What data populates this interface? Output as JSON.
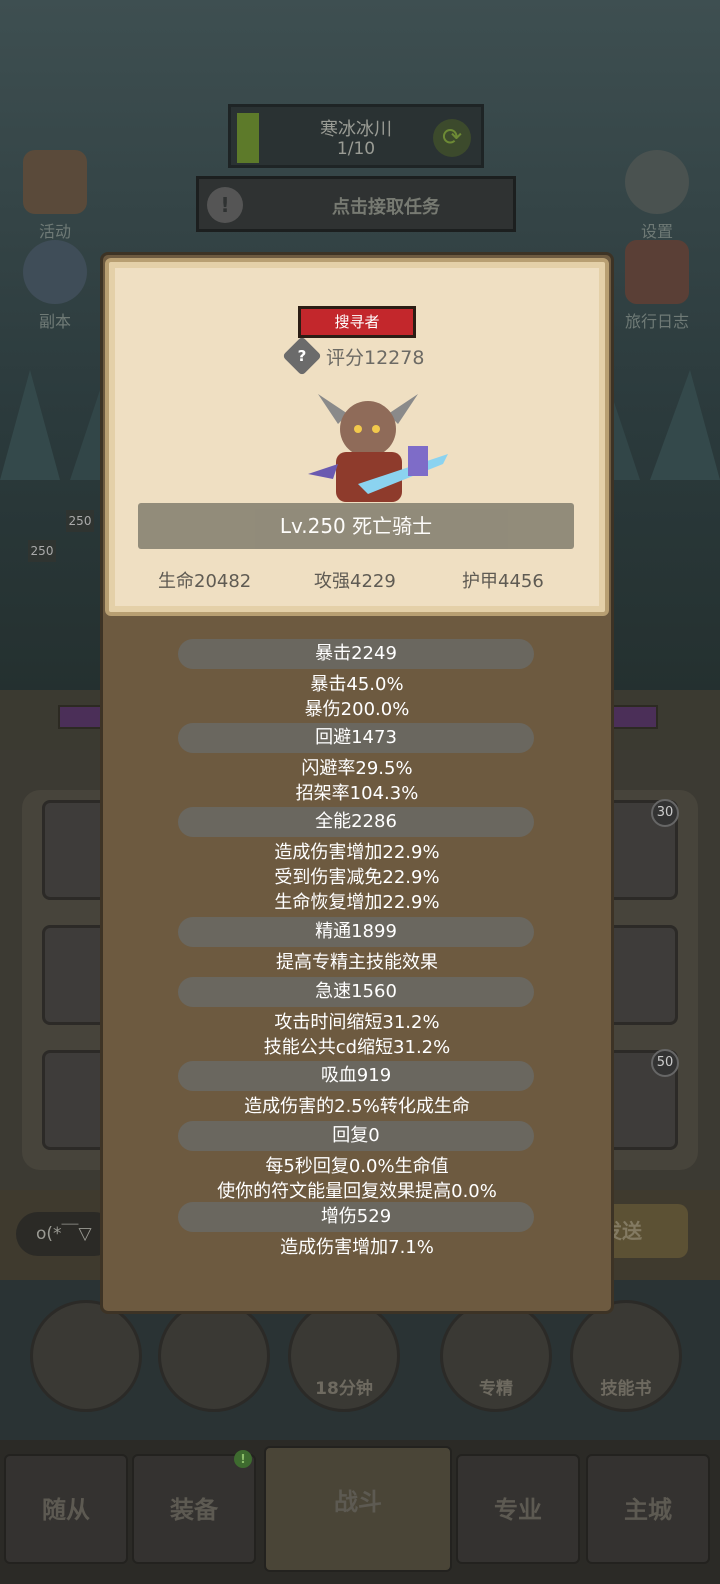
{
  "background": {
    "top_progress": {
      "title": "寒冰冰川",
      "progress": "1/10"
    },
    "task_text": "点击接取任务",
    "left_buttons": [
      {
        "label": "活动"
      },
      {
        "label": "副本"
      }
    ],
    "right_buttons": [
      {
        "label": "设置"
      },
      {
        "label": "旅行日志"
      }
    ],
    "level_badges": [
      "250",
      "250"
    ],
    "slot_badges": [
      "30",
      "50"
    ],
    "chat": {
      "input_text": "o(*￣▽",
      "send_label": "发送"
    },
    "bottom_actions": [
      {
        "label": ""
      },
      {
        "label": ""
      },
      {
        "label": "18分钟"
      },
      {
        "label": "专精"
      },
      {
        "label": "技能书"
      }
    ],
    "tabs": [
      {
        "label": "随从"
      },
      {
        "label": "装备",
        "badge": "!"
      },
      {
        "label": "战斗"
      },
      {
        "label": "专业"
      },
      {
        "label": "主城"
      }
    ]
  },
  "modal": {
    "class_badge": "搜寻者",
    "score": "评分12278",
    "name": "Lv.250 死亡骑士",
    "main_stats": [
      "生命20482",
      "攻强4229",
      "护甲4456"
    ],
    "stat_groups": [
      {
        "header": "暴击2249",
        "lines": [
          "暴击45.0%",
          "暴伤200.0%"
        ]
      },
      {
        "header": "回避1473",
        "lines": [
          "闪避率29.5%",
          "招架率104.3%"
        ]
      },
      {
        "header": "全能2286",
        "lines": [
          "造成伤害增加22.9%",
          "受到伤害减免22.9%",
          "生命恢复增加22.9%"
        ]
      },
      {
        "header": "精通1899",
        "lines": [
          "提高专精主技能效果"
        ]
      },
      {
        "header": "急速1560",
        "lines": [
          "攻击时间缩短31.2%",
          "技能公共cd缩短31.2%"
        ]
      },
      {
        "header": "吸血919",
        "lines": [
          "造成伤害的2.5%转化成生命"
        ]
      },
      {
        "header": "回复0",
        "lines": [
          "每5秒回复0.0%生命值",
          "使你的符文能量回复效果提高0.0%"
        ]
      },
      {
        "header": "增伤529",
        "lines": [
          "造成伤害增加7.1%"
        ]
      }
    ]
  },
  "colors": {
    "badge_red": "#c3272c",
    "parchment": "#efdfc2",
    "panel_brown": "#6d5a40",
    "pill_gray": "#6a675f"
  }
}
